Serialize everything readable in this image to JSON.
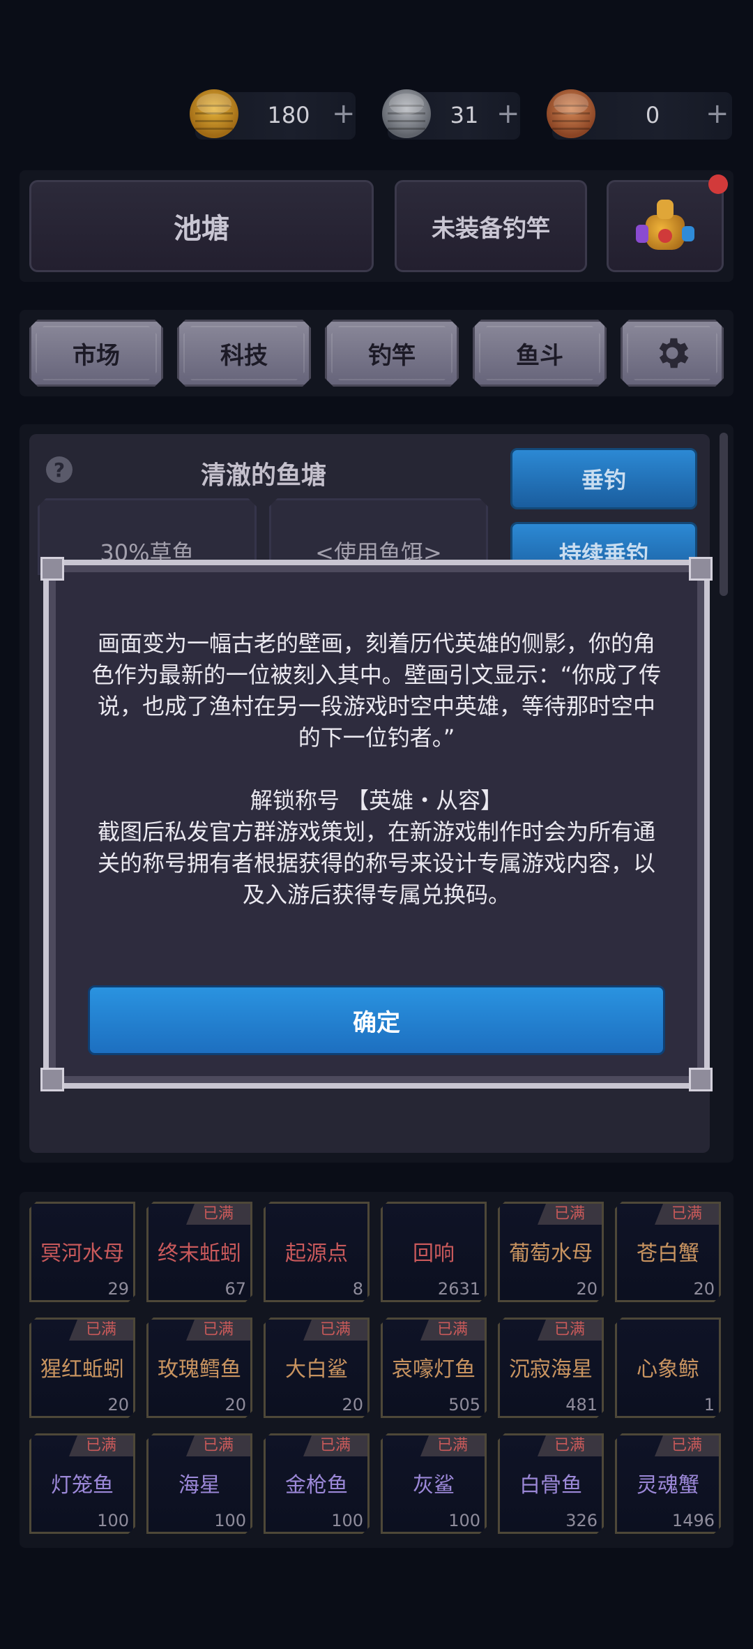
{
  "currencies": [
    {
      "name": "gold-coins",
      "icon": "gold-coin-stack-icon",
      "value": "180",
      "plus": "+"
    },
    {
      "name": "silver-coins",
      "icon": "silver-coin-stack-icon",
      "value": "31",
      "plus": "+"
    },
    {
      "name": "bronze-coins",
      "icon": "bronze-coin-stack-icon",
      "value": "0",
      "plus": "+"
    }
  ],
  "top_panel": {
    "pond_label": "池塘",
    "rod_label": "未装备钓竿",
    "treasure_icon": "treasure-pile-icon"
  },
  "nav": {
    "market": "市场",
    "tech": "科技",
    "rod": "钓竿",
    "fish_bucket": "鱼斗",
    "settings_icon": "gear-icon"
  },
  "pond": {
    "help": "?",
    "title": "清澈的鱼塘",
    "fish_rate": "30%草鱼",
    "bait": "<使用鱼饵>",
    "fish_button": "垂钓",
    "auto_fish_button": "持续垂钓"
  },
  "dialog": {
    "paragraph1": "画面变为一幅古老的壁画，刻着历代英雄的侧影，你的角色作为最新的一位被刻入其中。壁画引文显示：“你成了传说，也成了渔村在另一段游戏时空中英雄，等待那时空中的下一位钓者。”",
    "unlock_line": "解锁称号 【英雄・从容】",
    "paragraph2": "截图后私发官方群游戏策划，在新游戏制作时会为所有通关的称号拥有者根据获得的称号来设计专属游戏内容，以及入游后获得专属兑换码。",
    "confirm": "确定"
  },
  "fish_full_label": "已满",
  "fish_grid": [
    [
      {
        "name": "冥河水母",
        "count": "29",
        "full": false,
        "color": "red"
      },
      {
        "name": "终末蚯蚓",
        "count": "67",
        "full": true,
        "color": "red"
      },
      {
        "name": "起源点",
        "count": "8",
        "full": false,
        "color": "red"
      },
      {
        "name": "回响",
        "count": "2631",
        "full": false,
        "color": "red"
      },
      {
        "name": "葡萄水母",
        "count": "20",
        "full": true,
        "color": "orange"
      },
      {
        "name": "苍白蟹",
        "count": "20",
        "full": true,
        "color": "orange"
      }
    ],
    [
      {
        "name": "猩红蚯蚓",
        "count": "20",
        "full": true,
        "color": "orange"
      },
      {
        "name": "玫瑰鳕鱼",
        "count": "20",
        "full": true,
        "color": "orange"
      },
      {
        "name": "大白鲨",
        "count": "20",
        "full": true,
        "color": "orange"
      },
      {
        "name": "哀嚎灯鱼",
        "count": "505",
        "full": true,
        "color": "orange"
      },
      {
        "name": "沉寂海星",
        "count": "481",
        "full": true,
        "color": "orange"
      },
      {
        "name": "心象鲸",
        "count": "1",
        "full": false,
        "color": "orange"
      }
    ],
    [
      {
        "name": "灯笼鱼",
        "count": "100",
        "full": true,
        "color": "purple"
      },
      {
        "name": "海星",
        "count": "100",
        "full": true,
        "color": "purple"
      },
      {
        "name": "金枪鱼",
        "count": "100",
        "full": true,
        "color": "purple"
      },
      {
        "name": "灰鲨",
        "count": "100",
        "full": true,
        "color": "purple"
      },
      {
        "name": "白骨鱼",
        "count": "326",
        "full": true,
        "color": "purple"
      },
      {
        "name": "灵魂蟹",
        "count": "1496",
        "full": true,
        "color": "purple"
      }
    ]
  ]
}
